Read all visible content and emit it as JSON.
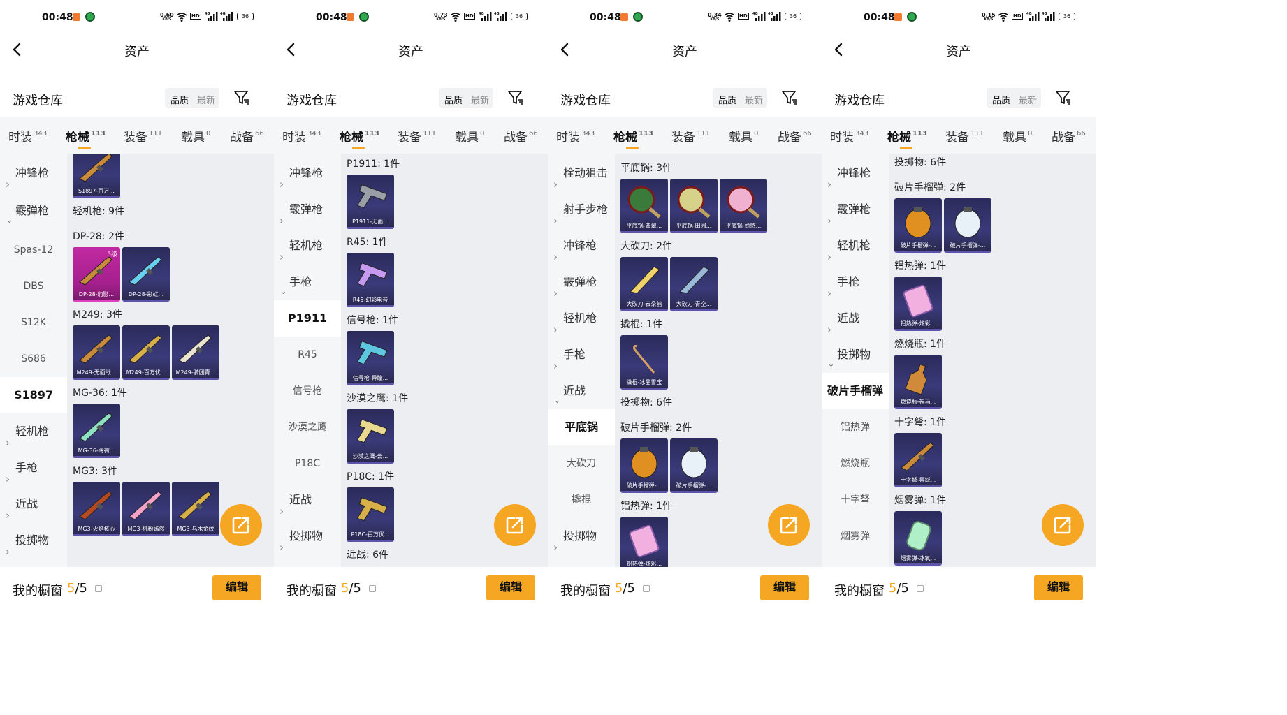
{
  "status": {
    "time": "00:48",
    "battery": "36",
    "speeds": [
      "0.60",
      "0.73",
      "0.34",
      "0.15"
    ],
    "speed_unit": "KB/S",
    "hd": "HD"
  },
  "header": {
    "title": "资产"
  },
  "warehouse": {
    "title": "游戏仓库",
    "sort_quality": "品质",
    "sort_latest": "最新"
  },
  "tabs": [
    {
      "label": "时装",
      "count": "343"
    },
    {
      "label": "枪械",
      "count": "113"
    },
    {
      "label": "装备",
      "count": "111"
    },
    {
      "label": "载具",
      "count": "0"
    },
    {
      "label": "战备",
      "count": "66"
    }
  ],
  "bottom": {
    "title": "我的橱窗",
    "count_current": "5",
    "count_sep": "/5",
    "edit": "编辑"
  },
  "panels": [
    {
      "sidebar": [
        {
          "kind": "cat",
          "label": "冲锋枪",
          "open": false
        },
        {
          "kind": "cat",
          "label": "霰弹枪",
          "open": true
        },
        {
          "kind": "sub",
          "label": "Spas-12"
        },
        {
          "kind": "sub",
          "label": "DBS"
        },
        {
          "kind": "sub",
          "label": "S12K"
        },
        {
          "kind": "sub",
          "label": "S686"
        },
        {
          "kind": "sel",
          "label": "S1897"
        },
        {
          "kind": "cat",
          "label": "轻机枪",
          "open": false
        },
        {
          "kind": "cat",
          "label": "手枪",
          "open": false
        },
        {
          "kind": "cat",
          "label": "近战",
          "open": false
        },
        {
          "kind": "cat",
          "label": "投掷物",
          "open": false
        }
      ],
      "groups": [
        {
          "label": "",
          "items": [
            {
              "name": "S1897-百万...",
              "icon": "shotgun"
            }
          ]
        },
        {
          "label": "轻机枪: 9件",
          "items": []
        },
        {
          "label": "DP-28: 2件",
          "items": [
            {
              "name": "DP-28-豹影...",
              "icon": "lmg",
              "level": "5级",
              "pink": true
            },
            {
              "name": "DP-28-彩虹...",
              "icon": "lmg-color"
            }
          ]
        },
        {
          "label": "M249: 3件",
          "items": [
            {
              "name": "M249-无面战...",
              "icon": "lmg"
            },
            {
              "name": "M249-百万伏...",
              "icon": "lmg-gold"
            },
            {
              "name": "M249-骑团青...",
              "icon": "lmg-white"
            }
          ]
        },
        {
          "label": "MG-36: 1件",
          "items": [
            {
              "name": "MG-36-薄荷...",
              "icon": "lmg-mint"
            }
          ]
        },
        {
          "label": "MG3: 3件",
          "items": [
            {
              "name": "MG3-火焰核心",
              "icon": "lmg-red"
            },
            {
              "name": "MG3-桃粉嫣然",
              "icon": "lmg-pink"
            },
            {
              "name": "MG3-乌木金纹",
              "icon": "lmg-gold"
            }
          ]
        }
      ]
    },
    {
      "sidebar": [
        {
          "kind": "cat",
          "label": "冲锋枪",
          "open": false
        },
        {
          "kind": "cat",
          "label": "霰弹枪",
          "open": false
        },
        {
          "kind": "cat",
          "label": "轻机枪",
          "open": false
        },
        {
          "kind": "cat",
          "label": "手枪",
          "open": true
        },
        {
          "kind": "sel",
          "label": "P1911"
        },
        {
          "kind": "sub",
          "label": "R45"
        },
        {
          "kind": "sub",
          "label": "信号枪"
        },
        {
          "kind": "sub",
          "label": "沙漠之鹰"
        },
        {
          "kind": "sub",
          "label": "P18C"
        },
        {
          "kind": "cat",
          "label": "近战",
          "open": false
        },
        {
          "kind": "cat",
          "label": "投掷物",
          "open": false
        }
      ],
      "groups": [
        {
          "label": "P1911: 1件",
          "items": [
            {
              "name": "P1911-无面...",
              "icon": "pistol"
            }
          ]
        },
        {
          "label": "R45: 1件",
          "items": [
            {
              "name": "R45-幻彩电音",
              "icon": "revolver"
            }
          ]
        },
        {
          "label": "信号枪: 1件",
          "items": [
            {
              "name": "信号枪-异瞳...",
              "icon": "flare"
            }
          ]
        },
        {
          "label": "沙漠之鹰: 1件",
          "items": [
            {
              "name": "沙漠之鹰-云...",
              "icon": "deagle"
            }
          ]
        },
        {
          "label": "P18C: 1件",
          "items": [
            {
              "name": "P18C-百万伏...",
              "icon": "pistol-gold"
            }
          ]
        },
        {
          "label": "近战: 6件",
          "items": []
        }
      ]
    },
    {
      "sidebar": [
        {
          "kind": "cat",
          "label": "栓动狙击",
          "open": false
        },
        {
          "kind": "cat",
          "label": "射手步枪",
          "open": false
        },
        {
          "kind": "cat",
          "label": "冲锋枪",
          "open": false
        },
        {
          "kind": "cat",
          "label": "霰弹枪",
          "open": false
        },
        {
          "kind": "cat",
          "label": "轻机枪",
          "open": false
        },
        {
          "kind": "cat",
          "label": "手枪",
          "open": false
        },
        {
          "kind": "cat",
          "label": "近战",
          "open": true
        },
        {
          "kind": "sel",
          "label": "平底锅"
        },
        {
          "kind": "sub",
          "label": "大砍刀"
        },
        {
          "kind": "sub",
          "label": "撬棍"
        },
        {
          "kind": "cat",
          "label": "投掷物",
          "open": false
        }
      ],
      "groups": [
        {
          "label": "平底锅: 3件",
          "items": [
            {
              "name": "平底锅-翡翠...",
              "icon": "pan-green"
            },
            {
              "name": "平底锅-田园...",
              "icon": "pan-cream"
            },
            {
              "name": "平底锅-娇憨...",
              "icon": "pan-pink"
            }
          ]
        },
        {
          "label": "大砍刀: 2件",
          "items": [
            {
              "name": "大砍刀-云朵鹤",
              "icon": "machete-gold"
            },
            {
              "name": "大砍刀-青空...",
              "icon": "machete-blue"
            }
          ]
        },
        {
          "label": "撬棍: 1件",
          "items": [
            {
              "name": "撬棍-冰晶雪宝",
              "icon": "crowbar"
            }
          ]
        },
        {
          "label": "投掷物: 6件",
          "items": []
        },
        {
          "label": "破片手榴弹: 2件",
          "items": [
            {
              "name": "破片手榴弹-...",
              "icon": "grenade-orange"
            },
            {
              "name": "破片手榴弹-...",
              "icon": "grenade-white"
            }
          ]
        },
        {
          "label": "铝热弹: 1件",
          "items": [
            {
              "name": "铝热弹-炫彩...",
              "icon": "thermite"
            }
          ]
        }
      ]
    },
    {
      "sidebar": [
        {
          "kind": "cat",
          "label": "冲锋枪",
          "open": false
        },
        {
          "kind": "cat",
          "label": "霰弹枪",
          "open": false
        },
        {
          "kind": "cat",
          "label": "轻机枪",
          "open": false
        },
        {
          "kind": "cat",
          "label": "手枪",
          "open": false
        },
        {
          "kind": "cat",
          "label": "近战",
          "open": false
        },
        {
          "kind": "cat",
          "label": "投掷物",
          "open": true
        },
        {
          "kind": "sel",
          "label": "破片手榴弹"
        },
        {
          "kind": "sub",
          "label": "铝热弹"
        },
        {
          "kind": "sub",
          "label": "燃烧瓶"
        },
        {
          "kind": "sub",
          "label": "十字弩"
        },
        {
          "kind": "sub",
          "label": "烟雾弹"
        }
      ],
      "groups": [
        {
          "label": "投掷物: 6件",
          "items": []
        },
        {
          "label": "破片手榴弹: 2件",
          "items": [
            {
              "name": "破片手榴弹-...",
              "icon": "grenade-orange"
            },
            {
              "name": "破片手榴弹-...",
              "icon": "grenade-white"
            }
          ]
        },
        {
          "label": "铝热弹: 1件",
          "items": [
            {
              "name": "铝热弹-炫彩...",
              "icon": "thermite"
            }
          ]
        },
        {
          "label": "燃烧瓶: 1件",
          "items": [
            {
              "name": "燃烧瓶-福马...",
              "icon": "molotov"
            }
          ]
        },
        {
          "label": "十字弩: 1件",
          "items": [
            {
              "name": "十字弩-异域...",
              "icon": "crossbow"
            }
          ]
        },
        {
          "label": "烟雾弹: 1件",
          "items": [
            {
              "name": "烟雾弹-冰氧...",
              "icon": "smoke"
            }
          ]
        }
      ]
    }
  ]
}
